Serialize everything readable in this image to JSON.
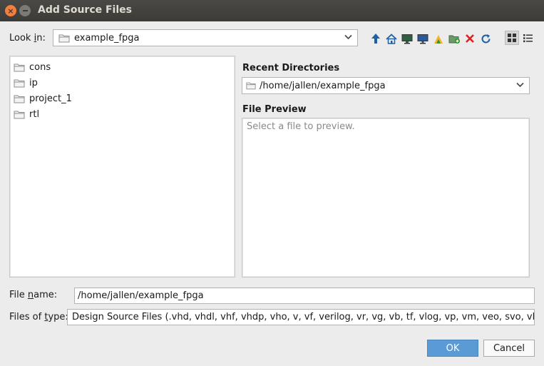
{
  "window": {
    "title": "Add Source Files"
  },
  "look_in": {
    "label_prefix": "Look ",
    "label_mnemonic": "i",
    "label_suffix": "n:",
    "value": "example_fpga"
  },
  "toolbar": {
    "icons": [
      "up-folder-icon",
      "home-icon",
      "desktop-icon",
      "computer-icon",
      "vivado-icon",
      "new-folder-icon",
      "delete-icon",
      "refresh-icon"
    ],
    "view_modes": [
      "icons-view-icon",
      "list-view-icon"
    ]
  },
  "files": [
    {
      "name": "cons"
    },
    {
      "name": "ip"
    },
    {
      "name": "project_1"
    },
    {
      "name": "rtl"
    }
  ],
  "recent": {
    "heading": "Recent Directories",
    "value": "/home/jallen/example_fpga"
  },
  "preview": {
    "heading": "File Preview",
    "placeholder": "Select a file to preview."
  },
  "file_name": {
    "label_prefix": "File ",
    "label_mnemonic": "n",
    "label_suffix": "ame:",
    "value": "/home/jallen/example_fpga"
  },
  "file_type": {
    "label_prefix": "Files of ",
    "label_mnemonic": "t",
    "label_suffix": "ype:",
    "value": "Design Source Files (.vhd, vhdl, vhf, vhdp, vho, v, vf, verilog, vr, vg, vb, tf, vlog, vp, vm, veo, svo, vh, h, svh"
  },
  "buttons": {
    "ok": "OK",
    "cancel": "Cancel"
  },
  "colors": {
    "accent": "#5b9bd5",
    "title_bar": "#3c3b37",
    "close": "#f57e3f",
    "delete": "#e02020",
    "up_arrow": "#1f5fa8"
  }
}
